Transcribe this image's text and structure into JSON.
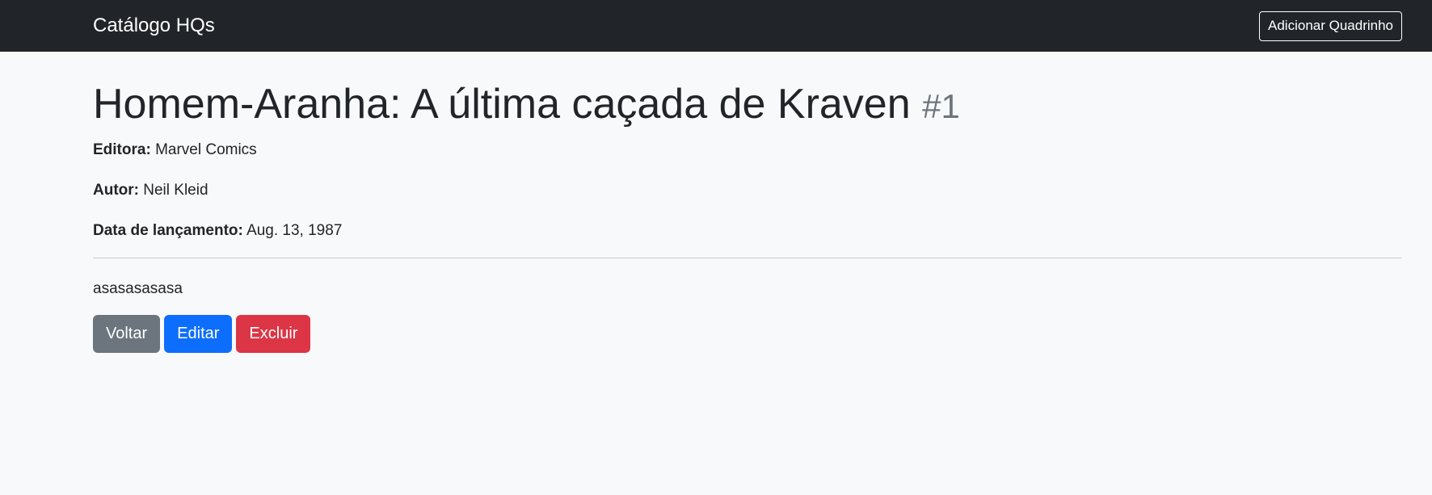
{
  "navbar": {
    "brand": "Catálogo HQs",
    "add_button": "Adicionar Quadrinho"
  },
  "comic": {
    "title": "Homem-Aranha: A última caçada de Kraven",
    "issue": "#1",
    "publisher_label": "Editora:",
    "publisher": "Marvel Comics",
    "author_label": "Autor:",
    "author": "Neil Kleid",
    "release_label": "Data de lançamento:",
    "release_date": "Aug. 13, 1987",
    "description": "asasasasasa"
  },
  "actions": {
    "back": "Voltar",
    "edit": "Editar",
    "delete": "Excluir"
  },
  "colors": {
    "navbar_bg": "#212529",
    "page_bg": "#f8f9fa",
    "secondary": "#6c757d",
    "primary": "#0d6efd",
    "danger": "#dc3545"
  }
}
